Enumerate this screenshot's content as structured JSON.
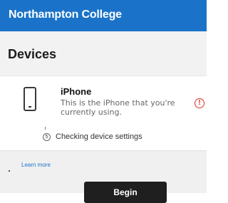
{
  "header": {
    "org_name": "Northampton College"
  },
  "page": {
    "title": "Devices"
  },
  "device": {
    "name": "iPhone",
    "description": "This is the iPhone that you're currently using.",
    "icon": "phone-icon",
    "status_icon": "alert-circle-icon",
    "status_color": "#d93025"
  },
  "status": {
    "text": "Checking device settings",
    "icon": "step-5-icon",
    "step": "5"
  },
  "links": {
    "learn_more": "Learn more"
  },
  "actions": {
    "begin": "Begin"
  },
  "colors": {
    "brand": "#1a73c8",
    "button": "#1f1f1f"
  }
}
